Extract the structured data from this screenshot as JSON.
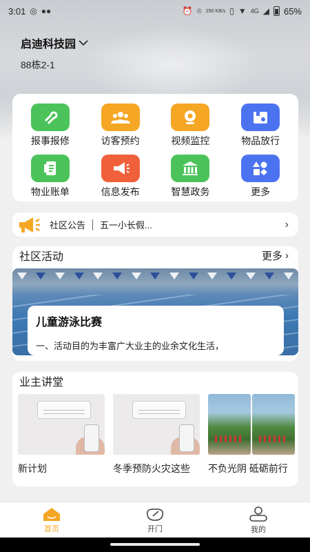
{
  "status_bar": {
    "time": "3:01",
    "battery": "65%",
    "network": "4G",
    "speed": "250 KB/s"
  },
  "location": {
    "name": "启迪科技园",
    "unit": "88栋2-1"
  },
  "services": [
    {
      "label": "报事报修",
      "icon": "wrench-icon",
      "color": "#4cc35a"
    },
    {
      "label": "访客预约",
      "icon": "visitors-icon",
      "color": "#f5a623"
    },
    {
      "label": "视频监控",
      "icon": "camera-icon",
      "color": "#f5a623"
    },
    {
      "label": "物品放行",
      "icon": "package-icon",
      "color": "#4b73f0"
    },
    {
      "label": "物业账单",
      "icon": "bill-icon",
      "color": "#4cc35a"
    },
    {
      "label": "信息发布",
      "icon": "megaphone-icon",
      "color": "#f0603a"
    },
    {
      "label": "智慧政务",
      "icon": "government-icon",
      "color": "#4cc35a"
    },
    {
      "label": "更多",
      "icon": "shapes-icon",
      "color": "#4b73f0"
    }
  ],
  "notice": {
    "label": "社区公告",
    "text": "五一小长假..."
  },
  "activity": {
    "title": "社区活动",
    "more": "更多",
    "event_title": "儿童游泳比赛",
    "event_desc": "一、活动目的为丰富广大业主的业余文化生活，"
  },
  "lecture": {
    "title": "业主讲堂",
    "items": [
      {
        "title": "新计划"
      },
      {
        "title": "冬季预防火灾这些"
      },
      {
        "title": "不负光阴 砥砺前行"
      }
    ]
  },
  "tabs": [
    {
      "label": "首页",
      "active": true
    },
    {
      "label": "开门",
      "active": false
    },
    {
      "label": "我的",
      "active": false
    }
  ],
  "colors": {
    "accent": "#f5a623",
    "green": "#4cc35a",
    "blue": "#4b73f0",
    "red": "#f0603a"
  }
}
